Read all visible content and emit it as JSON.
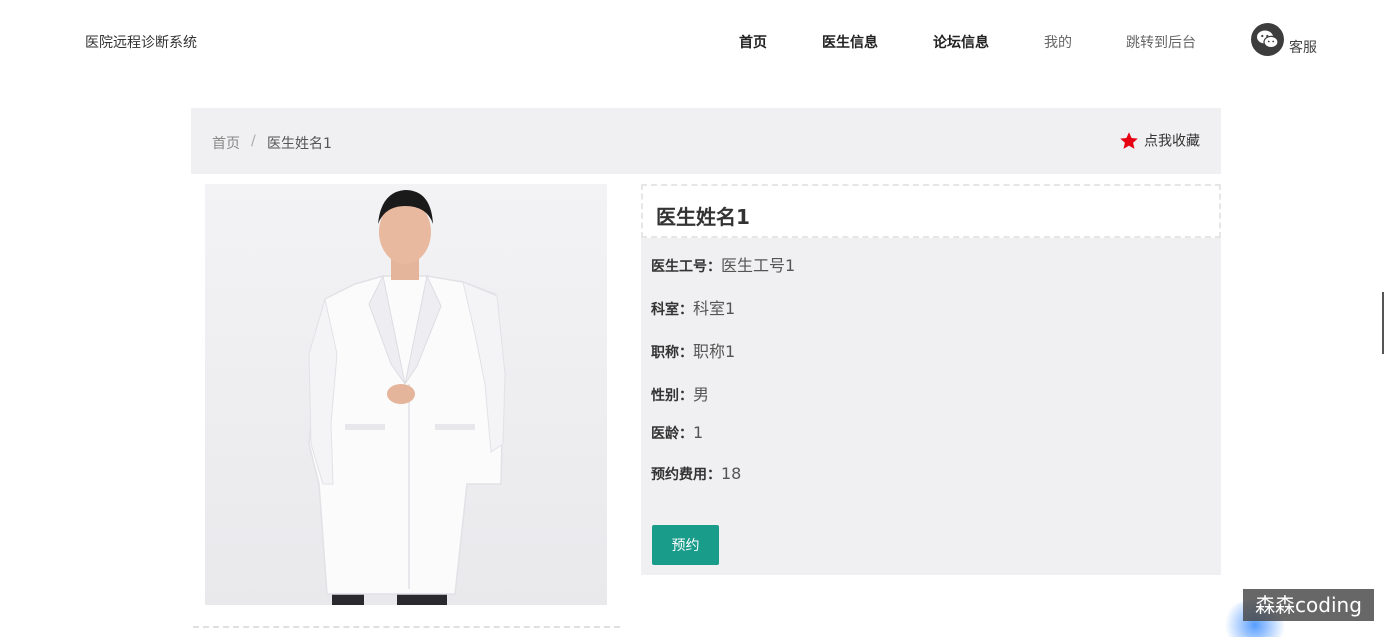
{
  "header": {
    "site_title": "医院远程诊断系统",
    "nav": [
      {
        "label": "首页"
      },
      {
        "label": "医生信息"
      },
      {
        "label": "论坛信息"
      },
      {
        "label": "我的"
      },
      {
        "label": "跳转到后台"
      }
    ],
    "service_label": "客服",
    "service_icon": "wechat-icon"
  },
  "breadcrumb": {
    "home": "首页",
    "separator": "/",
    "current": "医生姓名1"
  },
  "favorite": {
    "label": "点我收藏",
    "icon": "star-icon",
    "color": "#e60012"
  },
  "doctor": {
    "name": "医生姓名1",
    "fields": [
      {
        "label": "医生工号：",
        "value": "医生工号1"
      },
      {
        "label": "科室：",
        "value": "科室1"
      },
      {
        "label": "职称：",
        "value": "职称1"
      },
      {
        "label": "性别：",
        "value": "男"
      },
      {
        "label": "医龄：",
        "value": "1"
      },
      {
        "label": "预约费用：",
        "value": "18"
      }
    ],
    "book_button": "预约"
  },
  "colors": {
    "accent": "#1a9c8b",
    "panel_bg": "#f0f0f2"
  },
  "watermark": "森森coding"
}
